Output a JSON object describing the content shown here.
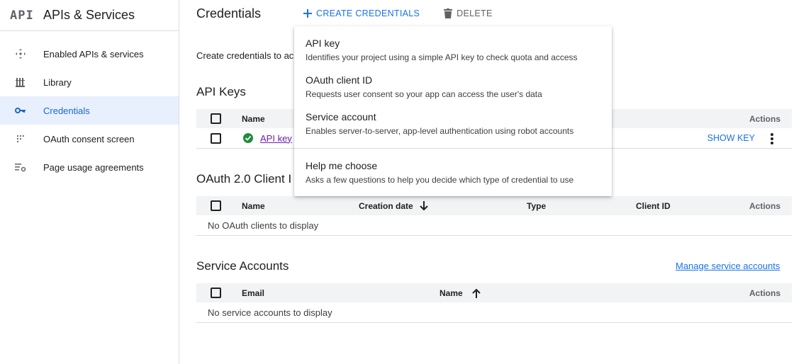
{
  "sidebar": {
    "logo": "API",
    "title": "APIs & Services",
    "items": [
      {
        "label": "Enabled APIs & services"
      },
      {
        "label": "Library"
      },
      {
        "label": "Credentials"
      },
      {
        "label": "OAuth consent screen"
      },
      {
        "label": "Page usage agreements"
      }
    ]
  },
  "topbar": {
    "title": "Credentials",
    "create_label": "CREATE CREDENTIALS",
    "delete_label": "DELETE"
  },
  "intro_text": "Create credentials to ac",
  "api_keys": {
    "title": "API Keys",
    "columns": {
      "name": "Name",
      "actions": "Actions"
    },
    "row": {
      "name": "API key",
      "show_key": "SHOW KEY"
    }
  },
  "oauth": {
    "title": "OAuth 2.0 Client I",
    "columns": {
      "name": "Name",
      "creation_date": "Creation date",
      "type": "Type",
      "client_id": "Client ID",
      "actions": "Actions"
    },
    "empty": "No OAuth clients to display"
  },
  "service_accounts": {
    "title": "Service Accounts",
    "manage_link": "Manage service accounts",
    "columns": {
      "email": "Email",
      "name": "Name",
      "actions": "Actions"
    },
    "empty": "No service accounts to display"
  },
  "menu": {
    "items": [
      {
        "title": "API key",
        "desc": "Identifies your project using a simple API key to check quota and access"
      },
      {
        "title": "OAuth client ID",
        "desc": "Requests user consent so your app can access the user's data"
      },
      {
        "title": "Service account",
        "desc": "Enables server-to-server, app-level authentication using robot accounts"
      },
      {
        "title": "Help me choose",
        "desc": "Asks a few questions to help you decide which type of credential to use"
      }
    ]
  },
  "colors": {
    "accent": "#1a73e8",
    "active_bg": "#e8f0fe",
    "success": "#1e8e3e"
  }
}
